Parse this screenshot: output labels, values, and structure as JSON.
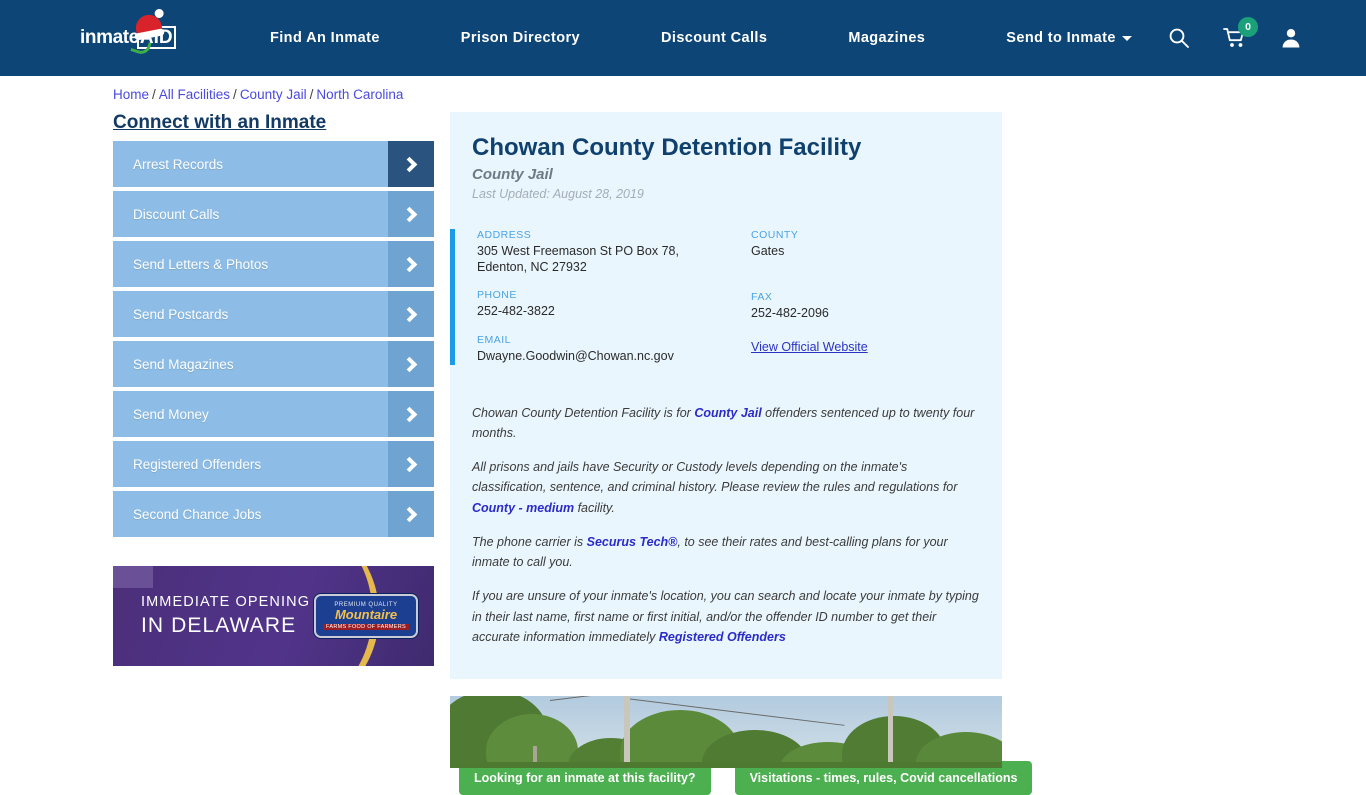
{
  "navbar": {
    "logo": {
      "part1": "inmate",
      "part2": "AID",
      "icon": "santa-hat-icon"
    },
    "links": [
      {
        "label": "Find An Inmate",
        "dropdown": false
      },
      {
        "label": "Prison Directory",
        "dropdown": false
      },
      {
        "label": "Discount Calls",
        "dropdown": false
      },
      {
        "label": "Magazines",
        "dropdown": false
      },
      {
        "label": "Send to Inmate",
        "dropdown": true
      }
    ],
    "icons": [
      {
        "name": "search-icon"
      },
      {
        "name": "cart-icon",
        "badge": "0"
      },
      {
        "name": "user-account-icon"
      }
    ],
    "bg_color": "#0d4576",
    "badge_color": "#1aa179"
  },
  "breadcrumb": {
    "items": [
      "Home",
      "All Facilities",
      "County Jail",
      "North Carolina"
    ],
    "separator": "/"
  },
  "sidebar": {
    "title": "Connect with an Inmate",
    "items": [
      {
        "label": "Arrest Records",
        "active": true
      },
      {
        "label": "Discount Calls",
        "active": false
      },
      {
        "label": "Send Letters & Photos",
        "active": false
      },
      {
        "label": "Send Postcards",
        "active": false
      },
      {
        "label": "Send Magazines",
        "active": false
      },
      {
        "label": "Send Money",
        "active": false
      },
      {
        "label": "Registered Offenders",
        "active": false
      },
      {
        "label": "Second Chance Jobs",
        "active": false
      }
    ]
  },
  "ad": {
    "line1": "IMMEDIATE OPENING",
    "line2": "IN DELAWARE",
    "logo_top": "PREMIUM QUALITY",
    "logo_main": "Mountaire",
    "logo_sub": "FARMS FOOD OF FARMERS"
  },
  "facility": {
    "title": "Chowan County Detention Facility",
    "subtitle": "County Jail",
    "last_updated": "Last Updated: August 28, 2019",
    "info": {
      "address_label": "ADDRESS",
      "address_line1": "305 West Freemason St PO Box 78,",
      "address_line2": "Edenton, NC 27932",
      "county_label": "COUNTY",
      "county_value": "Gates",
      "phone_label": "PHONE",
      "phone_value": "252-482-3822",
      "fax_label": "FAX",
      "fax_value": "252-482-2096",
      "email_label": "EMAIL",
      "email_value": "Dwayne.Goodwin@Chowan.nc.gov",
      "website_link": "View Official Website"
    },
    "paragraphs": [
      {
        "pre": "Chowan County Detention Facility is for ",
        "link": "County Jail",
        "post": " offenders sentenced up to twenty four months."
      },
      {
        "pre": "All prisons and jails have Security or Custody levels depending on the inmate's classification, sentence, and criminal history. Please review the rules and regulations for ",
        "link": "County - medium",
        "post": " facility."
      },
      {
        "pre": "The phone carrier is ",
        "link": "Securus Tech®",
        "post": ", to see their rates and best-calling plans for your inmate to call you."
      },
      {
        "pre": "If you are unsure of your inmate's location, you can search and locate your inmate by typing in their last name, first name or first initial, and/or the offender ID number to get their accurate information immediately ",
        "link": "Registered Offenders",
        "post": ""
      }
    ]
  },
  "cta": {
    "buttons": [
      {
        "label": "Looking for an inmate at this facility?"
      },
      {
        "label": "Visitations - times, rules, Covid cancellations"
      }
    ],
    "color": "#4caf50"
  },
  "photo": {
    "name": "facility-street-view-photo"
  },
  "colors": {
    "nav_bg": "#0d4576",
    "panel_bg": "#eaf6fd",
    "accent_bar": "#1b9ae8",
    "sidebar_item": "#8dbde6",
    "sidebar_arrow": "#6fa3d2",
    "sidebar_arrow_active": "#2a5380",
    "link": "#2b2bc9",
    "title": "#10416e"
  }
}
